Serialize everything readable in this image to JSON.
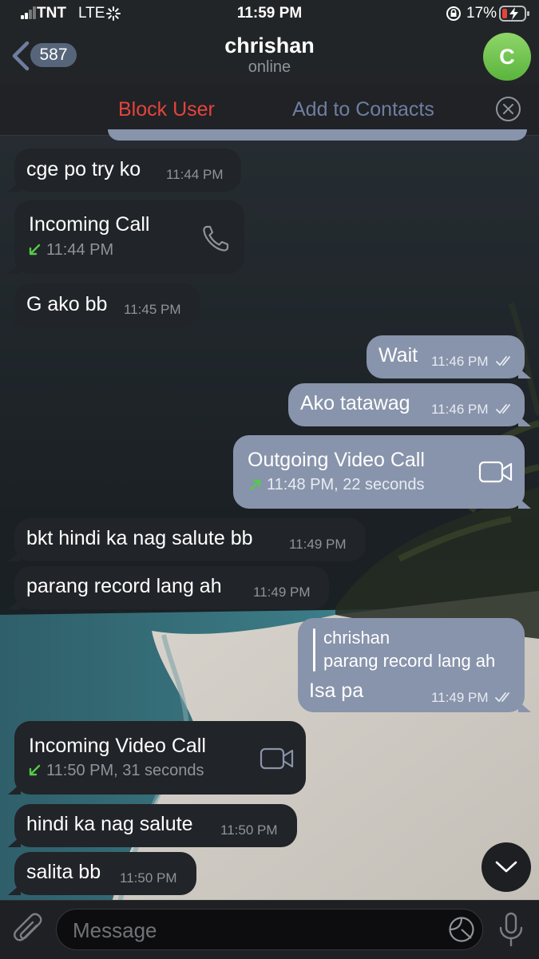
{
  "status_bar": {
    "carrier": "TNT",
    "network": "LTE",
    "time": "11:59 PM",
    "battery": "17%"
  },
  "header": {
    "back_count": "587",
    "name": "chrishan",
    "status": "online",
    "avatar_letter": "C"
  },
  "actions": {
    "block": "Block User",
    "add": "Add to Contacts"
  },
  "messages": [
    {
      "text": "cge po try ko",
      "time": "11:44 PM"
    },
    {
      "title": "Incoming Call",
      "time": "11:44 PM"
    },
    {
      "text": "G ako bb",
      "time": "11:45 PM"
    },
    {
      "text": "Wait",
      "time": "11:46 PM"
    },
    {
      "text": "Ako tatawag",
      "time": "11:46 PM"
    },
    {
      "title": "Outgoing Video Call",
      "time": "11:48 PM, 22 seconds"
    },
    {
      "text": "bkt hindi ka nag salute bb",
      "time": "11:49 PM"
    },
    {
      "text": "parang record lang ah",
      "time": "11:49 PM"
    },
    {
      "reply_name": "chrishan",
      "reply_text": "parang record lang ah",
      "text": "Isa pa",
      "time": "11:49 PM"
    },
    {
      "title": "Incoming Video Call",
      "time": "11:50 PM, 31 seconds"
    },
    {
      "text": "hindi ka nag salute",
      "time": "11:50 PM"
    },
    {
      "text": "salita bb",
      "time": "11:50 PM"
    }
  ],
  "input": {
    "placeholder": "Message"
  },
  "colors": {
    "accent": "#6f7ea0",
    "danger": "#e5443b",
    "call_arrow": "#56c94a",
    "outgoing_bubble": "#8894ab",
    "incoming_bubble": "#212428"
  }
}
